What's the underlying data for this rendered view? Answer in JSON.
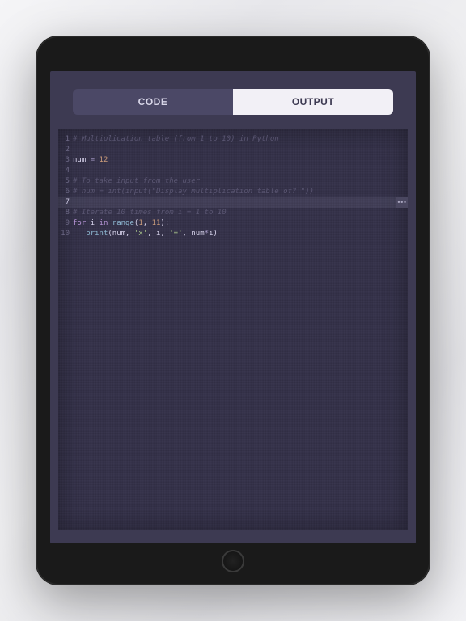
{
  "tabs": {
    "code": "CODE",
    "output": "OUTPUT"
  },
  "editor": {
    "current_line": 7,
    "line_count": 10,
    "lines": {
      "1": {
        "type": "comment",
        "text": "# Multiplication table (from 1 to 10) in Python"
      },
      "2": {
        "type": "blank",
        "text": ""
      },
      "3": {
        "type": "assign",
        "var": "num",
        "op": " = ",
        "num": "12"
      },
      "4": {
        "type": "blank",
        "text": ""
      },
      "5": {
        "type": "comment",
        "text": "# To take input from the user"
      },
      "6": {
        "type": "comment",
        "text": "# num = int(input(\"Display multiplication table of? \"))"
      },
      "7": {
        "type": "blank",
        "text": ""
      },
      "8": {
        "type": "comment",
        "text": "# Iterate 10 times from i = 1 to 10"
      },
      "9": {
        "type": "for",
        "kw1": "for",
        "var1": " i ",
        "kw2": "in",
        "func": " range",
        "open": "(",
        "n1": "1",
        "comma": ", ",
        "n2": "11",
        "close": "):"
      },
      "10": {
        "type": "print",
        "indent": "   ",
        "func": "print",
        "open": "(",
        "v1": "num",
        "c1": ", ",
        "s1": "'x'",
        "c2": ", ",
        "v2": "i",
        "c3": ", ",
        "s2": "'='",
        "c4": ", ",
        "v3": "num",
        "op": "*",
        "v4": "i",
        "close": ")"
      }
    }
  }
}
